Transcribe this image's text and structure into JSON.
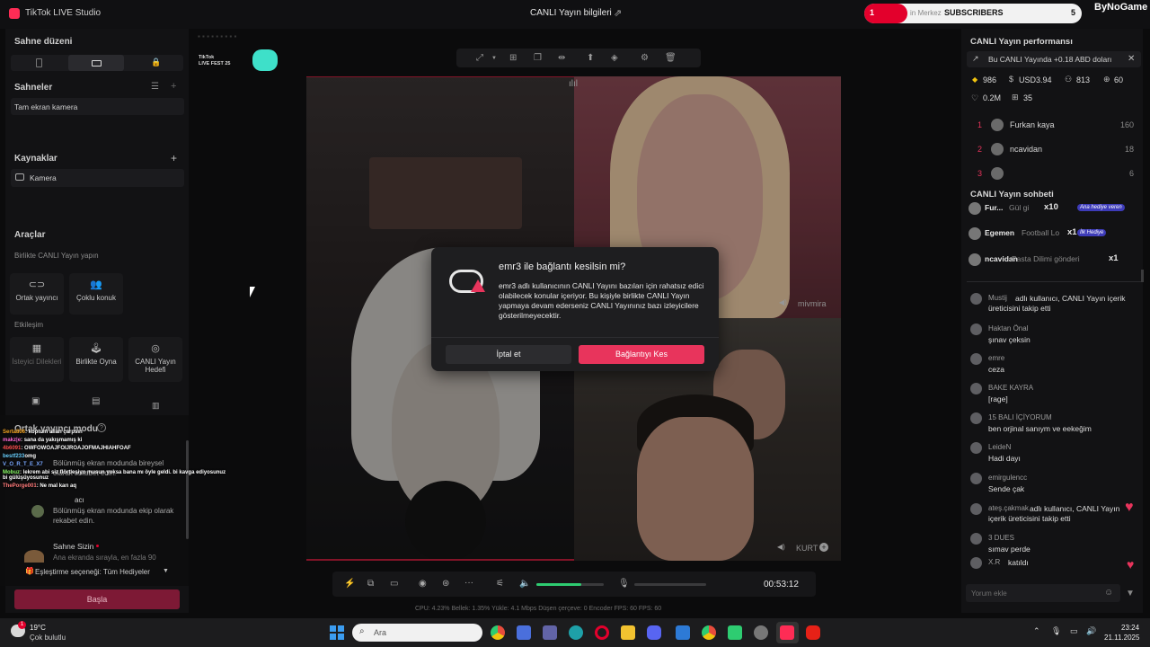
{
  "window": {
    "app_title": "TikTok LIVE Studio",
    "live_info": "CANLI Yayın bilgileri"
  },
  "subs_widget": {
    "count_left": "1",
    "label": "SUBSCRIBERS",
    "count_right": "5",
    "overlay_text": "in Merkez",
    "brand": "ByNoGame"
  },
  "left": {
    "scene_layout": "Sahne düzeni",
    "scenes_title": "Sahneler",
    "scene_item": "Tam ekran kamera",
    "sources_title": "Kaynaklar",
    "source_item": "Kamera",
    "tools_title": "Araçlar",
    "collab_label": "Birlikte CANLI Yayın yapın",
    "tool_cohost": "Ortak yayıncı",
    "tool_multiguest": "Çoklu konuk",
    "interaction_label": "Etkileşim",
    "tool_wishes": "İsteyici Dilekleri",
    "tool_play": "Birlikte Oyna",
    "tool_goal": "CANLI Yayın Hedefi",
    "cohost_mode": "Ortak yayıncı modu",
    "mode1_desc": "Bölünmüş ekran modunda bireysel olarak rekabet edin.",
    "team_label": "acı",
    "mode2_desc": "Bölünmüş ekran modunda ekip olarak rekabet edin.",
    "sahne_sizin": "Sahne Sizin",
    "sahne_desc": "Ana ekranda sırayla, en fazla 90",
    "match_option": "Eşleştirme seçeneği: Tüm Hediyeler",
    "start_button": "Başla"
  },
  "overlay_chat": [
    {
      "user": "Serta806",
      "msg": ": koptum allah çarpsın",
      "color": "#f5a623"
    },
    {
      "user": "makz|e",
      "msg": ": sana da yakışmamış ki",
      "color": "#ff6bd6"
    },
    {
      "user": "4b6091",
      "msg": ": OWFOWOAJFOIJROAJOFMAJHIAHFOAF",
      "color": "#ff5050"
    },
    {
      "user": "bestf233",
      "msg": "omg",
      "color": "#6ad0ff"
    },
    {
      "user": "V_O_R_T_E_X7",
      "msg": "",
      "color": "#7aa8ff"
    },
    {
      "user": "Mobuz",
      "msg": ": lekrem abi siz flörtleşiyo musun yoksa bana mı öyle geldi. bi kavga ediyosunuz bi gülüşüyosunuz",
      "color": "#8dff6a"
    },
    {
      "user": "ThePorge001",
      "msg": ": Ne mal karı aq",
      "color": "#ff7a7a"
    }
  ],
  "stage": {
    "cam_name_2": "mivmira",
    "cam_name_3": "KURT"
  },
  "dialog": {
    "title": "emr3 ile bağlantı kesilsin mi?",
    "body": "emr3 adlı kullanıcının CANLI Yayını bazıları için rahatsız edici olabilecek konular içeriyor. Bu kişiyle birlikte CANLI Yayın yapmaya devam ederseniz CANLI Yayınınız bazı izleyicilere gösterilmeyecektir.",
    "cancel": "İptal et",
    "disconnect": "Bağlantıyı Kes"
  },
  "controls": {
    "timer": "00:53:12",
    "stats": "CPU: 4.23%   Bellek: 1.35%   Yükle: 4.1 Mbps   Düşen çerçeve: 0   Encoder FPS: 60   FPS: 60"
  },
  "right": {
    "perf_title": "CANLI Yayın performansı",
    "banner": "Bu CANLI Yayında +0.18 ABD doları",
    "stat_gems": "986",
    "stat_usd": "USD3.94",
    "stat_viewers": "813",
    "stat_coins": "60",
    "stat_likes": "0.2M",
    "stat_gifts": "35",
    "ranking": [
      {
        "rank": "1",
        "name": "Furkan kaya",
        "score": "160"
      },
      {
        "rank": "2",
        "name": "ncavidan",
        "score": "18"
      },
      {
        "rank": "3",
        "name": "",
        "score": "6"
      }
    ],
    "chat_title": "CANLI Yayın sohbeti",
    "gifts": [
      {
        "name": "Fur...",
        "gift": "Gül gi",
        "count": "x10",
        "badge": "Ana hediye veren"
      },
      {
        "name": "Egemen",
        "gift": "Football Lo",
        "count": "x1",
        "badge": "İlk Hediye"
      },
      {
        "name": "ncavidan",
        "gift": "Pasta Dilimi gönderi",
        "count": "x1",
        "badge": ""
      }
    ],
    "chat": [
      {
        "name": "Mustij",
        "msg": "adlı kullanıcı, CANLI Yayın içerik üreticisini takip etti"
      },
      {
        "name": "Haktan Önal",
        "msg": "şınav çeksin"
      },
      {
        "name": "emre",
        "msg": "ceza"
      },
      {
        "name": "BAKE KAYRA",
        "msg": "[rage]"
      },
      {
        "name": "15 BALI İÇİYORUM",
        "msg": "ben orjinal sanıym ve eekeğim"
      },
      {
        "name": "LeideN",
        "msg": "Hadi dayı"
      },
      {
        "name": "emirgulencc",
        "msg": "Sende çak"
      },
      {
        "name": "ateş.çakmak",
        "msg": "adlı kullanıcı, CANLI Yayın içerik üreticisini takip etti"
      },
      {
        "name": "3 DUES",
        "msg": "sımav perde"
      },
      {
        "name": "X.R",
        "msg": "katıldı"
      }
    ],
    "comment_placeholder": "Yorum ekle"
  },
  "taskbar": {
    "weather_temp": "19°C",
    "weather_desc": "Çok bulutlu",
    "search_placeholder": "Ara",
    "time": "23:24",
    "date": "21.11.2025"
  }
}
